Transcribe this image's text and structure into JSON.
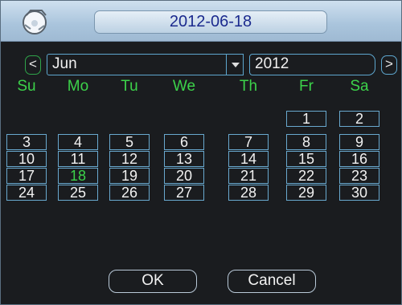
{
  "title": "2012-06-18",
  "nav": {
    "prev": "<",
    "next": ">"
  },
  "month": "Jun",
  "year": "2012",
  "weekdays": [
    "Su",
    "Mo",
    "Tu",
    "We",
    "Th",
    "Fr",
    "Sa"
  ],
  "days": [
    [
      null,
      null,
      null,
      null,
      null,
      "1",
      "2"
    ],
    [
      "3",
      "4",
      "5",
      "6",
      "7",
      "8",
      "9"
    ],
    [
      "10",
      "11",
      "12",
      "13",
      "14",
      "15",
      "16"
    ],
    [
      "17",
      "18",
      "19",
      "20",
      "21",
      "22",
      "23"
    ],
    [
      "24",
      "25",
      "26",
      "27",
      "28",
      "29",
      "30"
    ]
  ],
  "selected_day": "18",
  "buttons": {
    "ok": "OK",
    "cancel": "Cancel"
  },
  "colors": {
    "accent": "#3cd24a",
    "title_text": "#1b2a8e",
    "border": "#69a9cf"
  }
}
